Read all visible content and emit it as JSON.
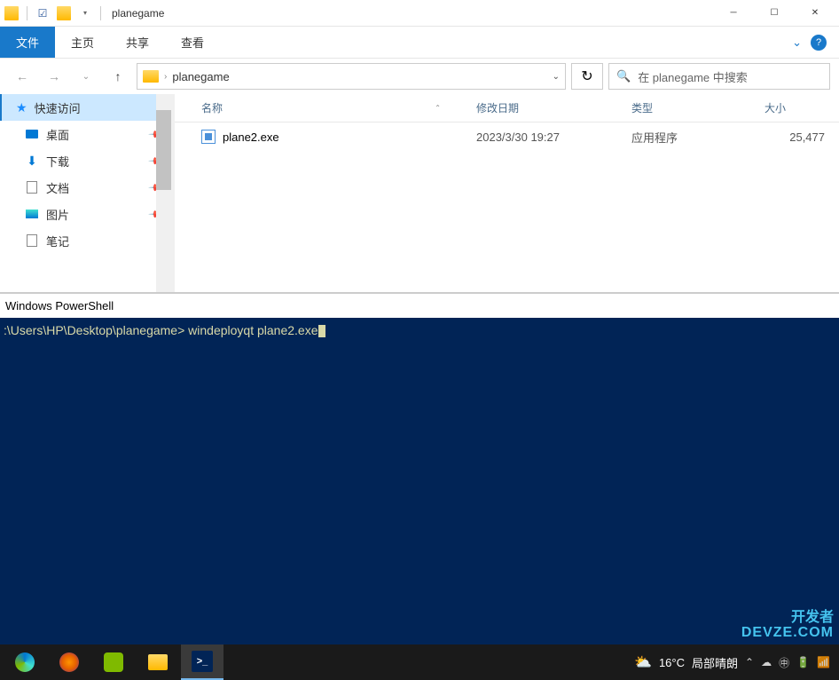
{
  "titlebar": {
    "title": "planegame"
  },
  "ribbon": {
    "file": "文件",
    "tabs": [
      "主页",
      "共享",
      "查看"
    ]
  },
  "address": {
    "path": "planegame",
    "search_placeholder": "在 planegame 中搜索"
  },
  "sidebar": {
    "quick_access": "快速访问",
    "items": [
      {
        "label": "桌面"
      },
      {
        "label": "下载"
      },
      {
        "label": "文档"
      },
      {
        "label": "图片"
      },
      {
        "label": "笔记"
      }
    ]
  },
  "columns": {
    "name": "名称",
    "date": "修改日期",
    "type": "类型",
    "size": "大小"
  },
  "files": [
    {
      "name": "plane2.exe",
      "date": "2023/3/30 19:27",
      "type": "应用程序",
      "size": "25,477 "
    }
  ],
  "powershell": {
    "title": "Windows PowerShell",
    "prompt": ":\\Users\\HP\\Desktop\\planegame> ",
    "command": "windeployqt plane2.exe"
  },
  "taskbar": {
    "weather_temp": "16°C",
    "weather_desc": "局部晴朗"
  },
  "watermark": {
    "line1": "开发者",
    "line2": "DEVZE.COM"
  }
}
